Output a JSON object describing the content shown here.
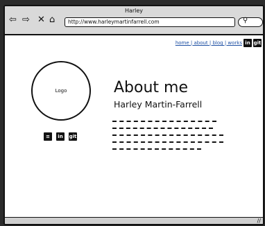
{
  "window": {
    "title": "Harley"
  },
  "browser": {
    "url": "http://www.harleymartinfarrell.com",
    "back_icon": "back-arrow-icon",
    "forward_icon": "forward-arrow-icon",
    "close_icon": "x-icon",
    "home_icon": "home-icon",
    "search_icon": "search-icon"
  },
  "nav": {
    "links_text": "home | about | blog | works",
    "linkedin_label": "in",
    "git_label": "git"
  },
  "logo": {
    "text": "Logo"
  },
  "social": {
    "doc_label": "",
    "linkedin_label": "in",
    "git_label": "git"
  },
  "main": {
    "heading": "About me",
    "subheading": "Harley Martin-Farrell"
  }
}
